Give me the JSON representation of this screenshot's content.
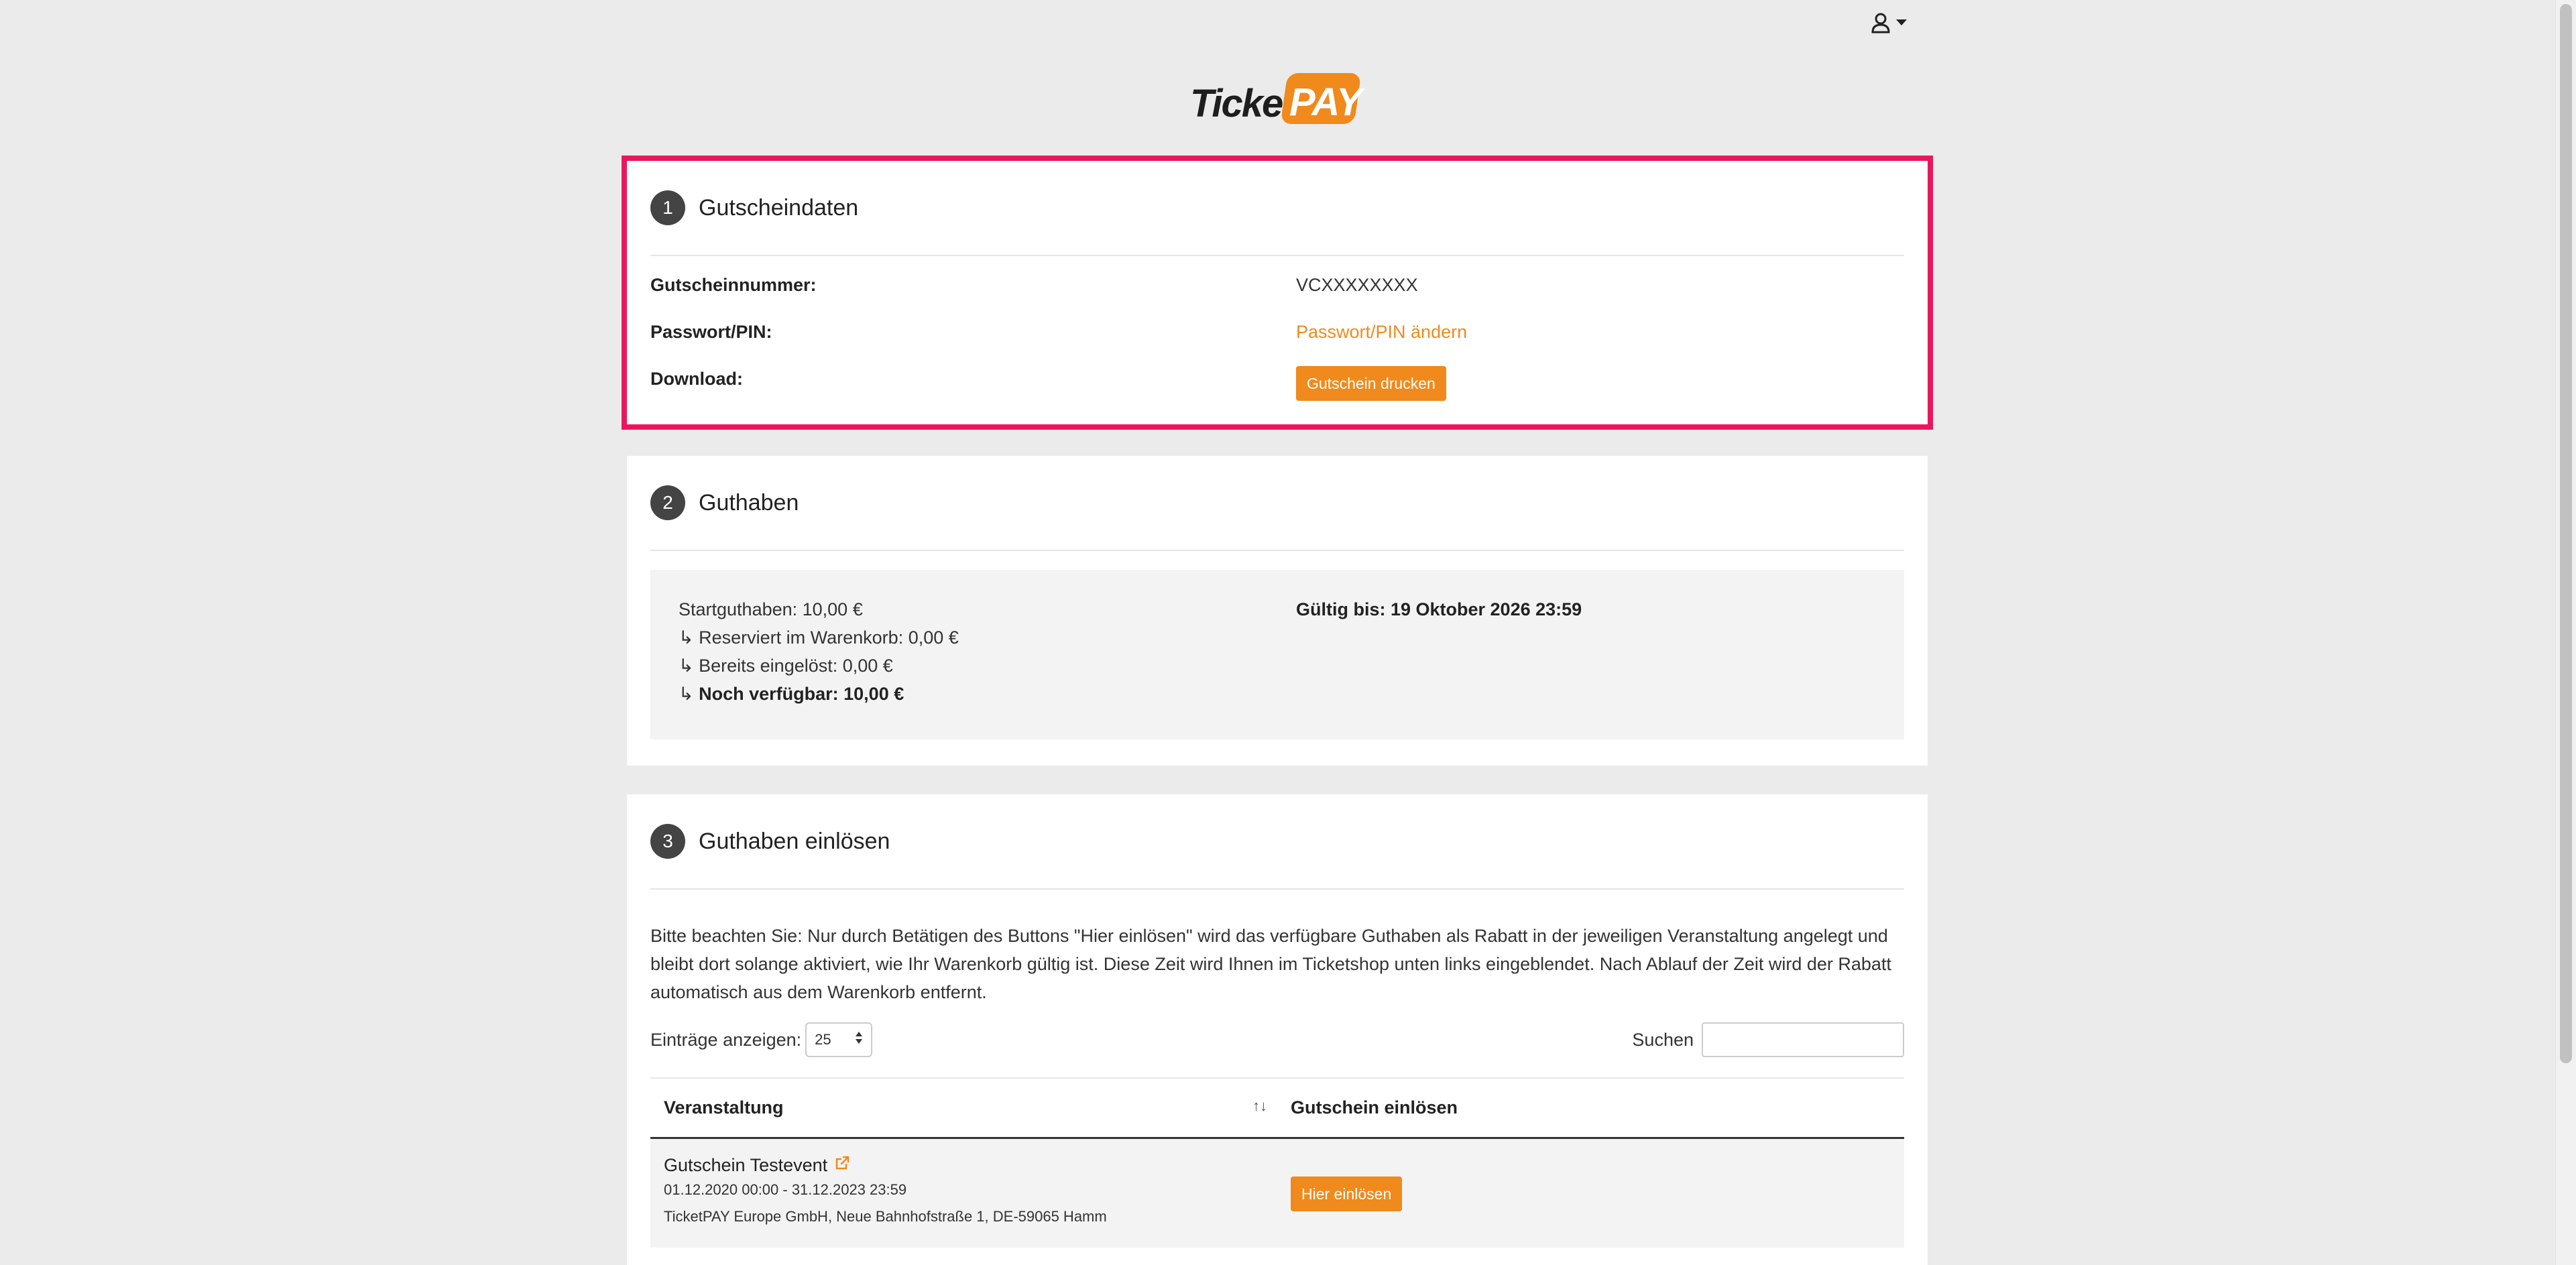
{
  "header": {
    "user_icon": "user-icon",
    "dropdown_icon": "caret-down-icon"
  },
  "brand": {
    "logo_ticket": "Ticket",
    "logo_pay": "PAY",
    "accent": "#f08a1c",
    "highlight": "#e8175d"
  },
  "section1": {
    "number": "1",
    "title": "Gutscheindaten",
    "rows": [
      {
        "label": "Gutscheinnummer:",
        "value": "VCXXXXXXXX"
      },
      {
        "label": "Passwort/PIN:",
        "value": "Passwort/PIN ändern"
      },
      {
        "label": "Download:",
        "value": "Gutschein drucken"
      }
    ]
  },
  "section2": {
    "number": "2",
    "title": "Guthaben",
    "start": "Startguthaben: 10,00 €",
    "reserved": "↳ Reserviert im Warenkorb: 0,00 €",
    "redeemed": "↳ Bereits eingelöst: 0,00 €",
    "available_prefix": "↳ ",
    "available": "Noch verfügbar: 10,00 €",
    "valid_until": "Gültig bis: 19 Oktober 2026 23:59"
  },
  "section3": {
    "number": "3",
    "title": "Guthaben einlösen",
    "notice": "Bitte beachten Sie: Nur durch Betätigen des Buttons \"Hier einlösen\" wird das verfügbare Guthaben als Rabatt in der jeweiligen Veranstaltung angelegt und bleibt dort solange aktiviert, wie Ihr Warenkorb gültig ist. Diese Zeit wird Ihnen im Ticketshop unten links eingeblendet. Nach Ablauf der Zeit wird der Rabatt automatisch aus dem Warenkorb entfernt.",
    "entries_label": "Einträge anzeigen:",
    "entries_value": "25",
    "search_label": "Suchen",
    "search_value": "",
    "columns": [
      "Veranstaltung",
      "Gutschein einlösen"
    ],
    "rows": [
      {
        "event": "Gutschein Testevent",
        "dates": "01.12.2020 00:00 - 31.12.2023 23:59",
        "venue": "TicketPAY Europe GmbH, Neue Bahnhofstraße 1, DE-59065 Hamm",
        "action": "Hier einlösen"
      }
    ]
  }
}
